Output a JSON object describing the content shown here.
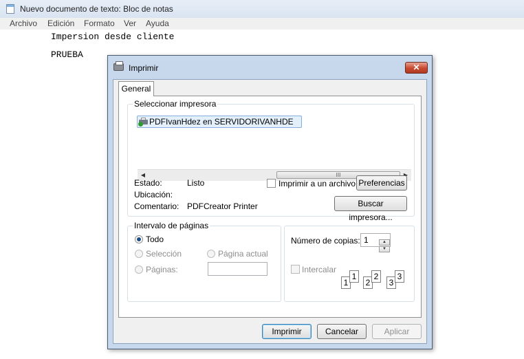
{
  "notepad": {
    "title": "Nuevo documento de texto: Bloc de notas",
    "menu": [
      "Archivo",
      "Edición",
      "Formato",
      "Ver",
      "Ayuda"
    ],
    "lines": [
      "Impersion desde cliente",
      "PRUEBA"
    ]
  },
  "dialog": {
    "title": "Imprimir",
    "close_symbol": "✕",
    "tab": "General",
    "select_printer": {
      "label": "Seleccionar impresora",
      "printer_name": "PDFIvanHdez en SERVIDORIVANHDE",
      "scroll_left": "◀",
      "scroll_right": "▶",
      "scroll_grip": "III"
    },
    "status": {
      "estado_label": "Estado:",
      "estado_value": "Listo",
      "ubicacion_label": "Ubicación:",
      "comentario_label": "Comentario:",
      "comentario_value": "PDFCreator Printer"
    },
    "print_to_file_label": "Imprimir a un archivo",
    "preferences_button": "Preferencias",
    "find_printer_button": "Buscar impresora...",
    "page_range": {
      "label": "Intervalo de páginas",
      "all": "Todo",
      "selection": "Selección",
      "current_page": "Página actual",
      "pages": "Páginas:"
    },
    "copies": {
      "label": "Número de copias:",
      "value": "1",
      "collate_label": "Intercalar",
      "collate_pages": [
        "1",
        "1",
        "2",
        "2",
        "3",
        "3"
      ],
      "spin_up": "▲",
      "spin_down": "▼"
    },
    "buttons": {
      "print": "Imprimir",
      "cancel": "Cancelar",
      "apply": "Aplicar"
    }
  },
  "colors": {
    "dialog_frame": "#c7d8ec",
    "selected_item": "#e3effb",
    "close_button": "#c7482f"
  }
}
